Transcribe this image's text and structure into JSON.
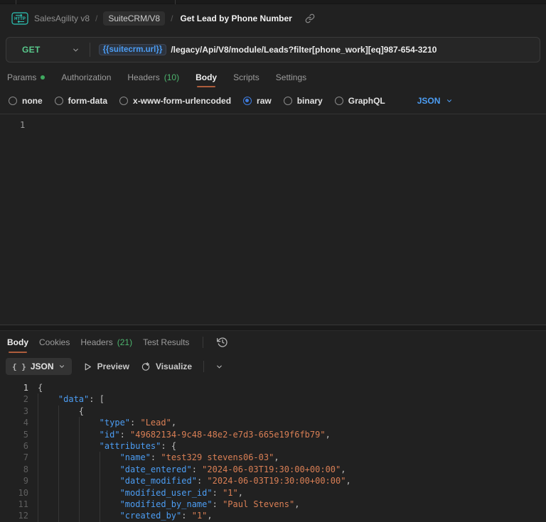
{
  "breadcrumb": {
    "collection": "SalesAgility v8",
    "separator": "/",
    "folder": "SuiteCRM/V8",
    "request_name": "Get Lead by Phone Number"
  },
  "request": {
    "method": "GET",
    "url_variable": "{{suitecrm.url}}",
    "url_path": "/legacy/Api/V8/module/Leads?filter[phone_work][eq]987-654-3210",
    "tabs": [
      {
        "label": "Params",
        "dot": true
      },
      {
        "label": "Authorization"
      },
      {
        "label": "Headers",
        "count": "(10)"
      },
      {
        "label": "Body",
        "active": true
      },
      {
        "label": "Scripts"
      },
      {
        "label": "Settings"
      }
    ],
    "body_types": [
      {
        "label": "none"
      },
      {
        "label": "form-data"
      },
      {
        "label": "x-www-form-urlencoded"
      },
      {
        "label": "raw",
        "selected": true
      },
      {
        "label": "binary"
      },
      {
        "label": "GraphQL"
      }
    ],
    "raw_language": "JSON",
    "editor_line_number": "1"
  },
  "response": {
    "tabs": [
      {
        "label": "Body",
        "active": true
      },
      {
        "label": "Cookies"
      },
      {
        "label": "Headers",
        "count": "(21)"
      },
      {
        "label": "Test Results"
      }
    ],
    "toolbar": {
      "format_label": "JSON",
      "braces_glyph": "{ }",
      "preview_label": "Preview",
      "visualize_label": "Visualize"
    },
    "body_lines": [
      {
        "n": "1",
        "indent": 0,
        "tokens": [
          [
            "p",
            "{"
          ]
        ]
      },
      {
        "n": "2",
        "indent": 1,
        "tokens": [
          [
            "k",
            "\"data\""
          ],
          [
            "p",
            ": ["
          ]
        ]
      },
      {
        "n": "3",
        "indent": 2,
        "tokens": [
          [
            "p",
            "{"
          ]
        ]
      },
      {
        "n": "4",
        "indent": 3,
        "tokens": [
          [
            "k",
            "\"type\""
          ],
          [
            "p",
            ": "
          ],
          [
            "s",
            "\"Lead\""
          ],
          [
            "p",
            ","
          ]
        ]
      },
      {
        "n": "5",
        "indent": 3,
        "tokens": [
          [
            "k",
            "\"id\""
          ],
          [
            "p",
            ": "
          ],
          [
            "s",
            "\"49682134-9c48-48e2-e7d3-665e19f6fb79\""
          ],
          [
            "p",
            ","
          ]
        ]
      },
      {
        "n": "6",
        "indent": 3,
        "tokens": [
          [
            "k",
            "\"attributes\""
          ],
          [
            "p",
            ": {"
          ]
        ]
      },
      {
        "n": "7",
        "indent": 4,
        "tokens": [
          [
            "k",
            "\"name\""
          ],
          [
            "p",
            ": "
          ],
          [
            "s",
            "\"test329 stevens06-03\""
          ],
          [
            "p",
            ","
          ]
        ]
      },
      {
        "n": "8",
        "indent": 4,
        "tokens": [
          [
            "k",
            "\"date_entered\""
          ],
          [
            "p",
            ": "
          ],
          [
            "s",
            "\"2024-06-03T19:30:00+00:00\""
          ],
          [
            "p",
            ","
          ]
        ]
      },
      {
        "n": "9",
        "indent": 4,
        "tokens": [
          [
            "k",
            "\"date_modified\""
          ],
          [
            "p",
            ": "
          ],
          [
            "s",
            "\"2024-06-03T19:30:00+00:00\""
          ],
          [
            "p",
            ","
          ]
        ]
      },
      {
        "n": "10",
        "indent": 4,
        "tokens": [
          [
            "k",
            "\"modified_user_id\""
          ],
          [
            "p",
            ": "
          ],
          [
            "s",
            "\"1\""
          ],
          [
            "p",
            ","
          ]
        ]
      },
      {
        "n": "11",
        "indent": 4,
        "tokens": [
          [
            "k",
            "\"modified_by_name\""
          ],
          [
            "p",
            ": "
          ],
          [
            "s",
            "\"Paul Stevens\""
          ],
          [
            "p",
            ","
          ]
        ]
      },
      {
        "n": "12",
        "indent": 4,
        "tokens": [
          [
            "k",
            "\"created_by\""
          ],
          [
            "p",
            ": "
          ],
          [
            "s",
            "\"1\""
          ],
          [
            "p",
            ","
          ]
        ]
      }
    ]
  },
  "colors": {
    "method_green": "#59c98c",
    "count_green": "#4db56e",
    "active_tab_underline": "#ae5d3c",
    "variable_blue": "#4c9df3",
    "json_key_blue": "#4c9df3",
    "json_string_orange": "#d97f55",
    "http_icon_teal": "#2cc8b9",
    "selected_radio_blue": "#3f7de0"
  }
}
